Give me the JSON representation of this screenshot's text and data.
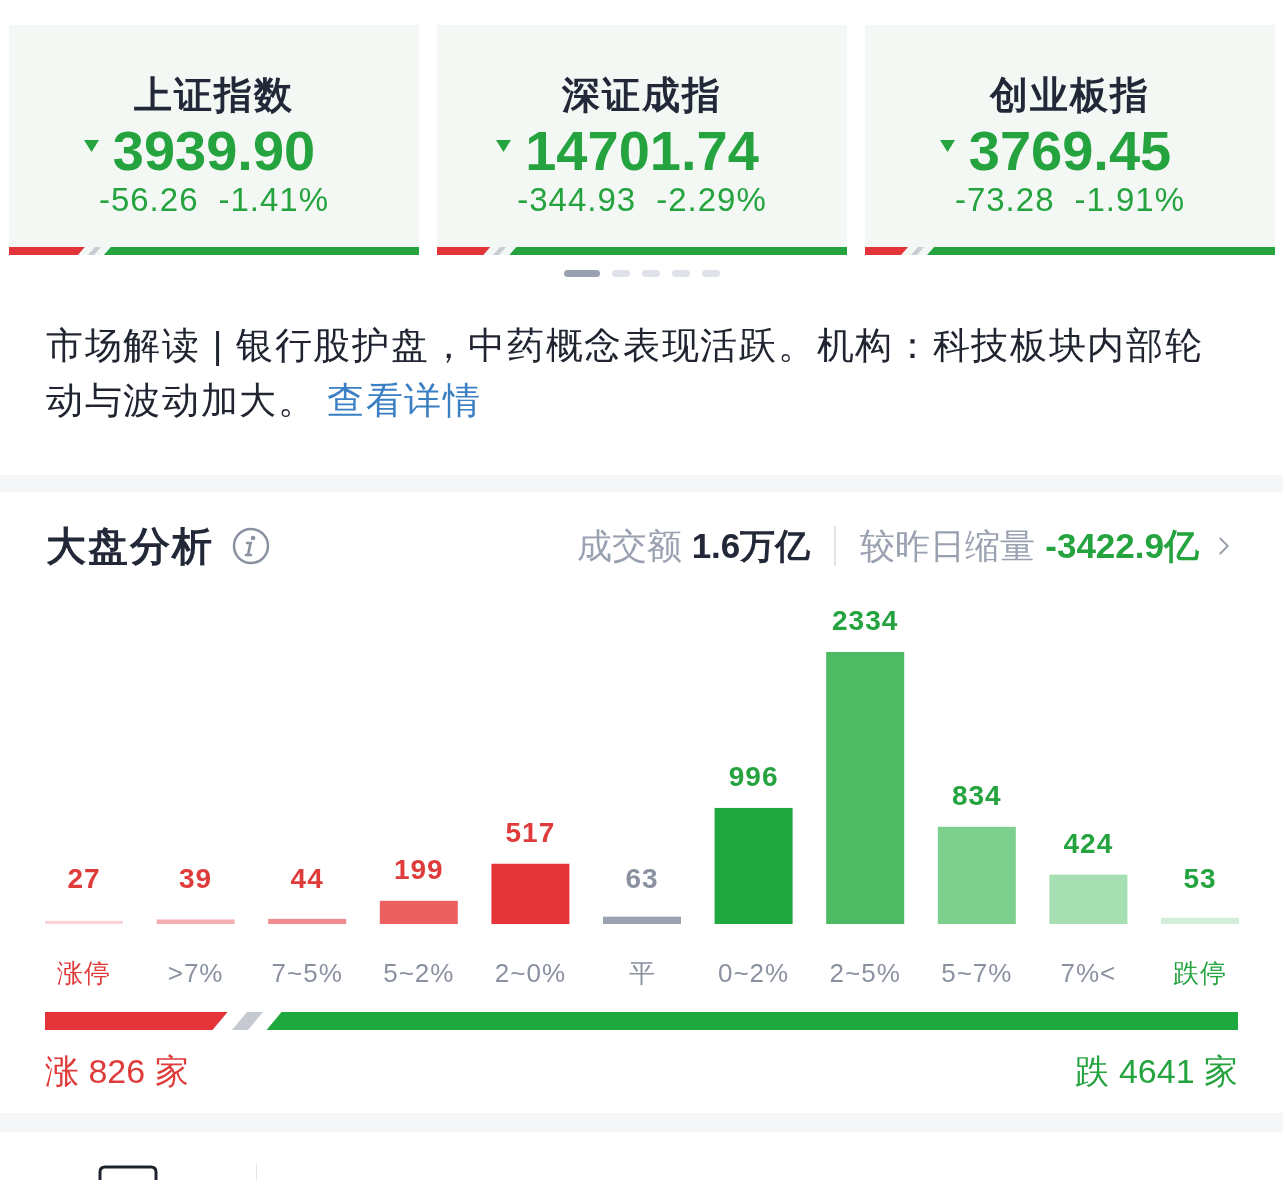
{
  "index_cards": [
    {
      "name": "上证指数",
      "falling": true,
      "value": "3939.90",
      "change": "-56.26",
      "percent": "-1.41%",
      "breadth": {
        "level": 0.185
      }
    },
    {
      "name": "深证成指",
      "falling": true,
      "value": "14701.74",
      "change": "-344.93",
      "percent": "-2.29%",
      "breadth": {
        "level": 0.13
      }
    },
    {
      "name": "创业板指",
      "falling": true,
      "value": "3769.45",
      "change": "-73.28",
      "percent": "-1.91%",
      "breadth": {
        "level": 0.105
      }
    }
  ],
  "pager": [
    {
      "selected": true
    },
    {
      "selected": false
    },
    {
      "selected": false
    },
    {
      "selected": false
    },
    {
      "selected": false
    }
  ],
  "commentary": {
    "text": "市场解读 | 银行股护盘，中药概念表现活跃。机构：科技板块内部轮动与波动加大。",
    "link": "查看详情"
  },
  "market_analysis": {
    "title": "大盘分析",
    "turnover_label": "成交额",
    "turnover": "1.6万亿",
    "compare_label": "较昨日缩量",
    "compare": "-3422.9亿"
  },
  "distribution": {
    "chart_data": {
      "type": "bar",
      "categories": [
        "涨停",
        ">7%",
        "7~5%",
        "5~2%",
        "2~0%",
        "平",
        "0~2%",
        "2~5%",
        "5~7%",
        "7%<",
        "跌停"
      ],
      "values": [
        27,
        39,
        44,
        199,
        517,
        63,
        996,
        2334,
        834,
        424,
        53
      ],
      "data_labels": true
    },
    "bars": [
      {
        "kind": "limit_up",
        "color": "#fdd5d6"
      },
      {
        "kind": "up",
        "color": "#f4aeb0"
      },
      {
        "kind": "up",
        "color": "#f08b8d"
      },
      {
        "kind": "up",
        "color": "#ec6062"
      },
      {
        "kind": "up",
        "color": "#e53437"
      },
      {
        "kind": "flat",
        "color": "#9aa1b1"
      },
      {
        "kind": "down",
        "color": "#1fa83d"
      },
      {
        "kind": "down",
        "color": "#4dbb63"
      },
      {
        "kind": "down",
        "color": "#7ccf8c"
      },
      {
        "kind": "down",
        "color": "#a6dfb2"
      },
      {
        "kind": "limit_down",
        "color": "#d3eed9"
      }
    ]
  },
  "breadth": {
    "level": 0.153,
    "up": "涨 826 家",
    "down": "跌 4641 家"
  }
}
